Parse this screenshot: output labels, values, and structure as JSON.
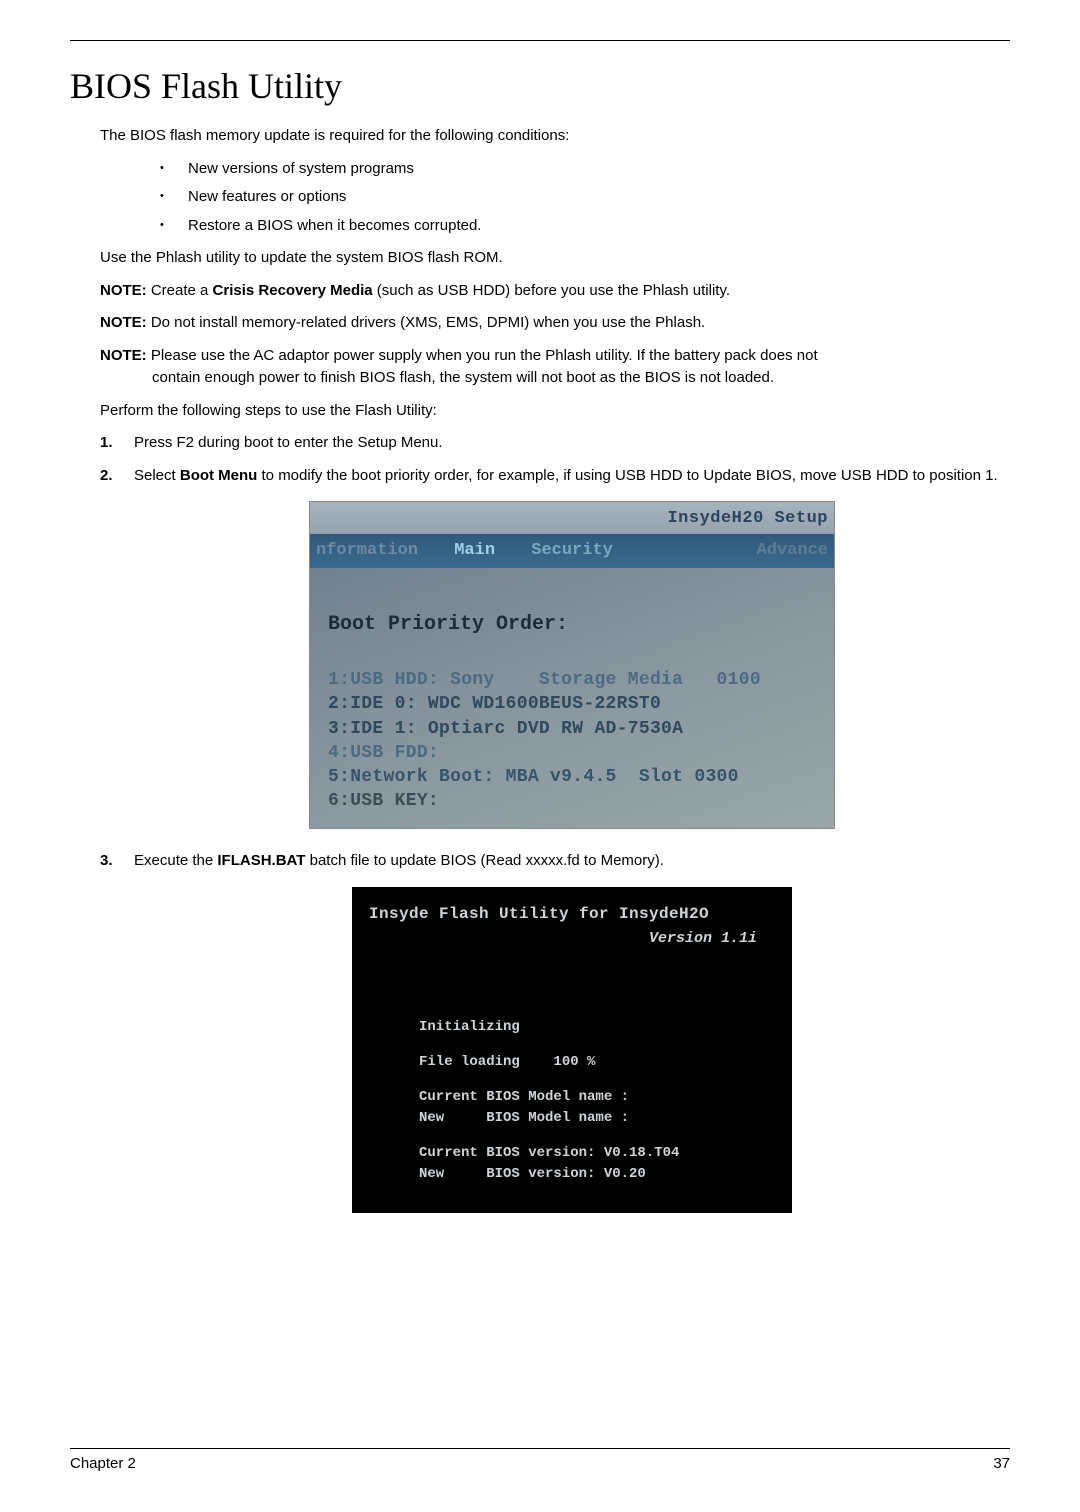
{
  "page": {
    "title": "BIOS Flash Utility",
    "intro": "The BIOS flash memory update is required for the following conditions:",
    "bullets": [
      "New versions of system programs",
      "New features or options",
      "Restore a BIOS when it becomes corrupted."
    ],
    "use_line": "Use the Phlash utility to update the system BIOS flash ROM.",
    "notes": {
      "label": "NOTE:",
      "n1_pre": " Create a ",
      "n1_bold": "Crisis Recovery Media",
      "n1_post": " (such as USB HDD) before you use the Phlash utility.",
      "n2": " Do not install memory-related drivers (XMS, EMS, DPMI) when you use the Phlash.",
      "n3a": " Please use the AC adaptor power supply when you run the Phlash utility. If the battery pack does not",
      "n3b": "contain enough power to finish BIOS flash, the system will not boot as the BIOS is not loaded."
    },
    "perform": "Perform the following steps to use the Flash Utility:",
    "steps": {
      "s1": "Press F2 during boot to enter the Setup Menu.",
      "s2_pre": "Select ",
      "s2_bold": "Boot Menu",
      "s2_post": " to modify the boot priority order, for example, if using USB HDD to Update BIOS, move USB HDD to position 1.",
      "s3_pre": "Execute the ",
      "s3_bold": "IFLASH.BAT",
      "s3_post": " batch file to update BIOS (Read xxxxx.fd to Memory)."
    }
  },
  "bios_setup": {
    "brand": "InsydeH20 Setup",
    "menu": {
      "info": "nformation",
      "main": "Main",
      "security": "Security",
      "advanced": "Advance"
    },
    "heading": "Boot Priority Order:",
    "entries": [
      "1:USB HDD: Sony    Storage Media   0100",
      "2:IDE 0: WDC WD1600BEUS-22RST0",
      "3:IDE 1: Optiarc DVD RW AD-7530A",
      "4:USB FDD:",
      "5:Network Boot: MBA v9.4.5  Slot 0300",
      "6:USB KEY:"
    ]
  },
  "flash_util": {
    "title": "Insyde Flash Utility for InsydeH2O",
    "version": "Version 1.1i",
    "lines": {
      "init": "Initializing",
      "file": "File loading    100 %",
      "cur_model": "Current BIOS Model name :",
      "new_model": "New     BIOS Model name :",
      "cur_ver": "Current BIOS version: V0.18.T04",
      "new_ver": "New     BIOS version: V0.20"
    }
  },
  "footer": {
    "left": "Chapter 2",
    "right": "37"
  }
}
